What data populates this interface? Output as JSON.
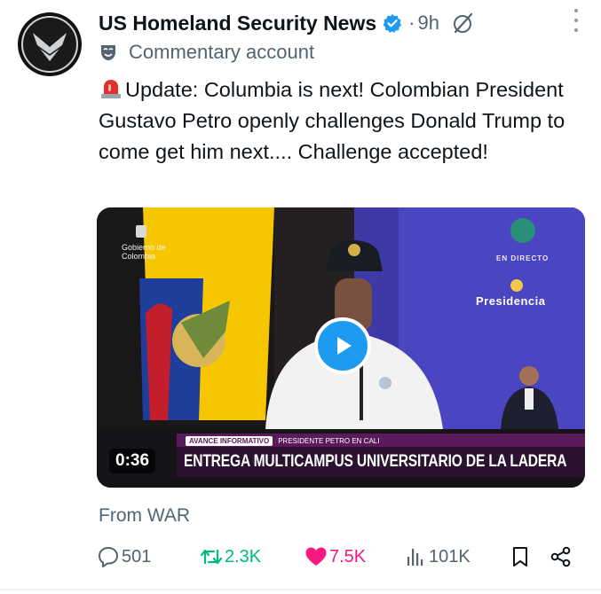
{
  "post": {
    "author_name": "US Homeland Security News",
    "dot": "·",
    "time": "9h",
    "label": "Commentary account",
    "text": "Update: Columbia is next! Colombian President Gustavo Petro openly challenges Donald Trump to come get him next.... Challenge accepted!",
    "source": "From WAR"
  },
  "video": {
    "duration": "0:36",
    "chyron_tag": "AVANCE INFORMATIVO",
    "chyron_sub": "PRESIDENTE PETRO EN CALI",
    "chyron_main": "ENTREGA MULTICAMPUS UNIVERSITARIO DE LA LADERA",
    "gov_text_line1": "Gobierno de",
    "gov_text_line2": "Colombia",
    "en_directo": "EN DIRECTO",
    "presidencia": "Presidencia"
  },
  "actions": {
    "replies": "501",
    "reposts": "2.3K",
    "likes": "7.5K",
    "views": "101K"
  },
  "icons": {
    "avatar": "shield-eagle-logo",
    "verified": "verified-badge-icon",
    "grok": "grok-icon",
    "more": "more-icon",
    "label": "commentary-mask-icon",
    "siren": "siren-emoji",
    "play": "play-icon",
    "reply": "reply-icon",
    "repost": "repost-icon",
    "like": "heart-icon",
    "views": "views-icon",
    "bookmark": "bookmark-icon",
    "share": "share-icon"
  },
  "colors": {
    "accent": "#1d9bf0",
    "repost": "#00ba7c",
    "like": "#f91880",
    "secondary_text": "#536471"
  }
}
